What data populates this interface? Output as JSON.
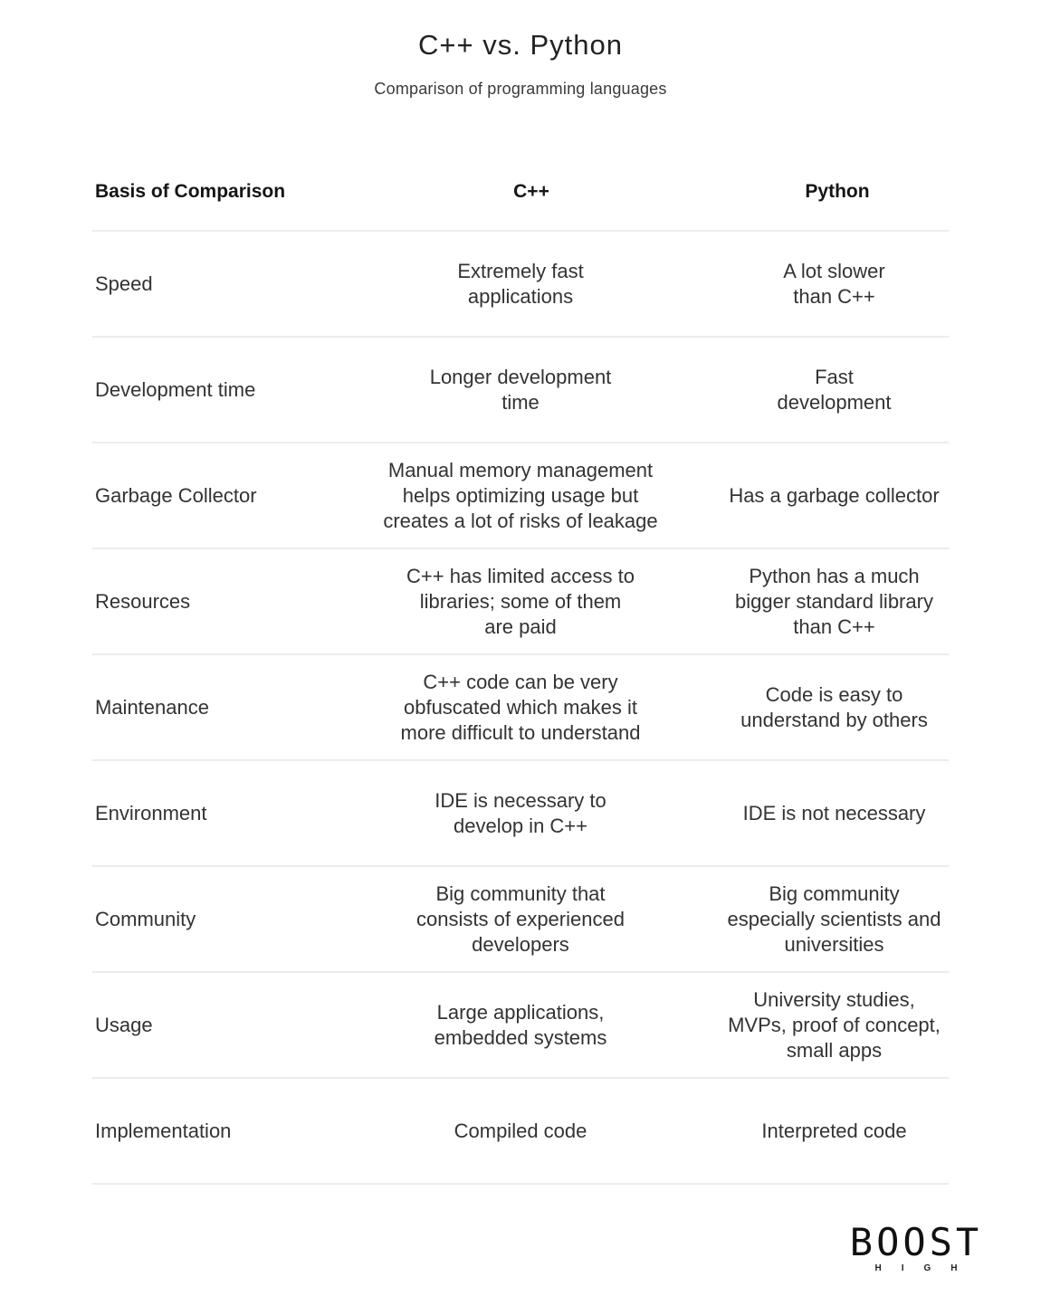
{
  "header": {
    "title": "C++ vs. Python",
    "subtitle": "Comparison of programming languages"
  },
  "table": {
    "columns": [
      "Basis of Comparison",
      "C++",
      "Python"
    ],
    "rows": [
      {
        "basis": "Speed",
        "cpp": "Extremely fast\napplications",
        "python": "A lot slower\nthan C++"
      },
      {
        "basis": "Development time",
        "cpp": "Longer development\ntime",
        "python": "Fast\ndevelopment"
      },
      {
        "basis": "Garbage Collector",
        "cpp": "Manual memory management\nhelps optimizing usage but\ncreates a lot of risks of leakage",
        "python": "Has a garbage collector"
      },
      {
        "basis": "Resources",
        "cpp": "C++ has limited access to\nlibraries; some of them\nare paid",
        "python": "Python has a much\nbigger standard library\nthan C++"
      },
      {
        "basis": "Maintenance",
        "cpp": "C++ code can be very\nobfuscated which makes it\nmore difficult to understand",
        "python": "Code is easy to\nunderstand by others"
      },
      {
        "basis": "Environment",
        "cpp": "IDE is necessary to\ndevelop in C++",
        "python": "IDE is not necessary"
      },
      {
        "basis": "Community",
        "cpp": "Big community that\nconsists of experienced\ndevelopers",
        "python": "Big community\nespecially scientists and\nuniversities"
      },
      {
        "basis": "Usage",
        "cpp": "Large applications,\nembedded systems",
        "python": "University studies,\nMVPs, proof of concept,\nsmall apps"
      },
      {
        "basis": "Implementation",
        "cpp": "Compiled code",
        "python": "Interpreted code"
      }
    ]
  },
  "logo": {
    "main": "BOOST",
    "sub": "HIGH"
  }
}
